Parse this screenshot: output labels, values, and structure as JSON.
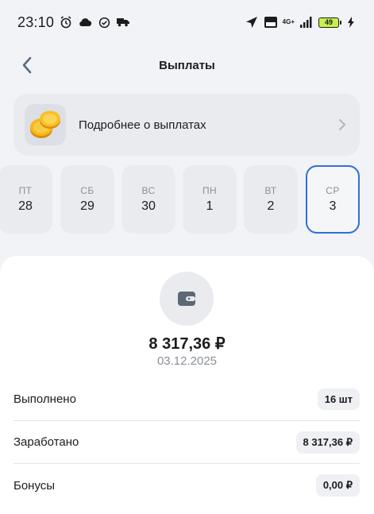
{
  "status_bar": {
    "time": "23:10",
    "network": "4G+",
    "battery": "49"
  },
  "header": {
    "title": "Выплаты"
  },
  "info_card": {
    "label": "Подробнее о выплатах"
  },
  "days": [
    {
      "name": "ПТ",
      "num": "28"
    },
    {
      "name": "СБ",
      "num": "29"
    },
    {
      "name": "ВС",
      "num": "30"
    },
    {
      "name": "ПН",
      "num": "1"
    },
    {
      "name": "ВТ",
      "num": "2"
    },
    {
      "name": "СР",
      "num": "3"
    }
  ],
  "summary": {
    "amount": "8 317,36 ₽",
    "date": "03.12.2025",
    "rows": [
      {
        "label": "Выполнено",
        "value": "16 шт"
      },
      {
        "label": "Заработано",
        "value": "8 317,36 ₽"
      },
      {
        "label": "Бонусы",
        "value": "0,00 ₽"
      }
    ]
  },
  "colors": {
    "accent": "#2f6fd8",
    "background": "#f2f3f6",
    "card": "#e9ebef"
  }
}
